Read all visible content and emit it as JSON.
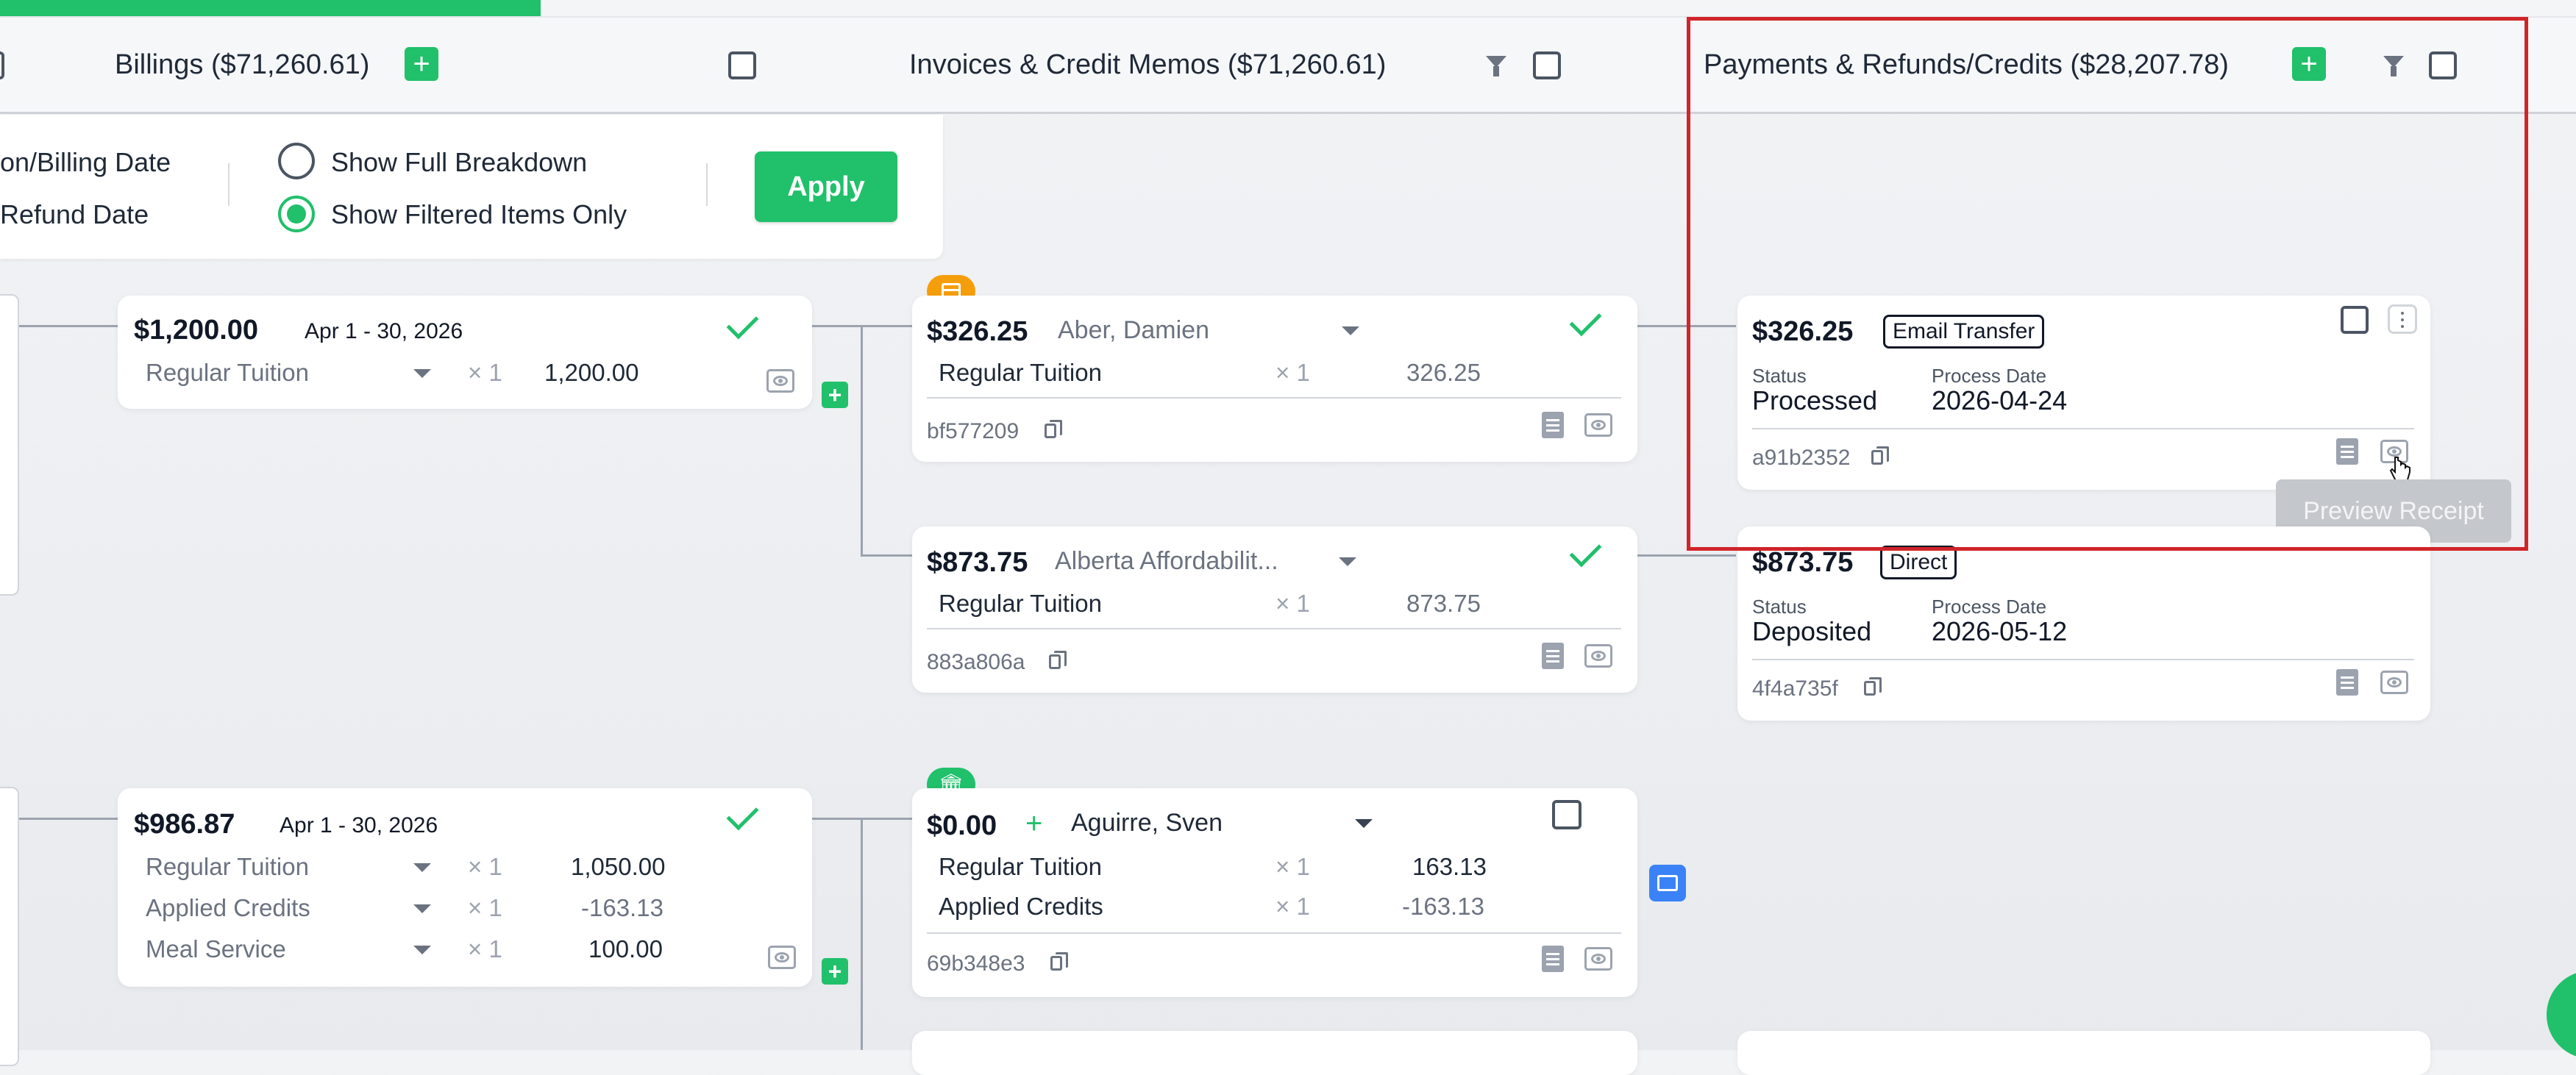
{
  "headers": {
    "billings": "Billings ($71,260.61)",
    "invoices": "Invoices & Credit Memos ($71,260.61)",
    "payments": "Payments & Refunds/Credits ($28,207.78)",
    "plus": "+"
  },
  "options": {
    "date_a": "on/Billing Date",
    "date_b": "Refund Date",
    "full_breakdown": "Show Full Breakdown",
    "filtered_only": "Show Filtered Items Only",
    "selected": "filtered_only",
    "apply": "Apply"
  },
  "billings": [
    {
      "amount": "$1,200.00",
      "date": "Apr 1 - 30, 2026",
      "lines": [
        {
          "label": "Regular Tuition",
          "qty": "× 1",
          "value": "1,200.00"
        }
      ]
    },
    {
      "amount": "$986.87",
      "date": "Apr 1 - 30, 2026",
      "lines": [
        {
          "label": "Regular Tuition",
          "qty": "× 1",
          "value": "1,050.00"
        },
        {
          "label": "Applied Credits",
          "qty": "× 1",
          "value": "-163.13"
        },
        {
          "label": "Meal Service",
          "qty": "× 1",
          "value": "100.00"
        }
      ]
    }
  ],
  "invoices": [
    {
      "amount": "$326.25",
      "name": "Aber, Damien",
      "lines": [
        {
          "label": "Regular Tuition",
          "qty": "× 1",
          "value": "326.25"
        }
      ],
      "code": "bf577209"
    },
    {
      "amount": "$873.75",
      "name": "Alberta Affordabilit...",
      "lines": [
        {
          "label": "Regular Tuition",
          "qty": "× 1",
          "value": "873.75"
        }
      ],
      "code": "883a806a"
    },
    {
      "amount": "$0.00",
      "plus": "+",
      "name": "Aguirre, Sven",
      "lines": [
        {
          "label": "Regular Tuition",
          "qty": "× 1",
          "value": "163.13"
        },
        {
          "label": "Applied Credits",
          "qty": "× 1",
          "value": "-163.13"
        }
      ],
      "code": "69b348e3"
    }
  ],
  "payments": [
    {
      "amount": "$326.25",
      "method": "Email Transfer",
      "status_label": "Status",
      "status": "Processed",
      "date_label": "Process Date",
      "date": "2026-04-24",
      "code": "a91b2352"
    },
    {
      "amount": "$873.75",
      "method": "Direct",
      "status_label": "Status",
      "status": "Deposited",
      "date_label": "Process Date",
      "date": "2026-05-12",
      "code": "4f4a735f"
    }
  ],
  "tooltip": "Preview Receipt",
  "colors": {
    "accent": "#21c06b",
    "highlight": "#d0242a",
    "warning": "#f59e0b",
    "info": "#3b82f6"
  },
  "icons": [
    "check-icon",
    "copy-icon",
    "document-icon",
    "eye-icon",
    "filter-icon",
    "caret-down-icon",
    "menu-dots-icon",
    "bank-icon",
    "card-icon",
    "pointer-cursor-icon"
  ]
}
